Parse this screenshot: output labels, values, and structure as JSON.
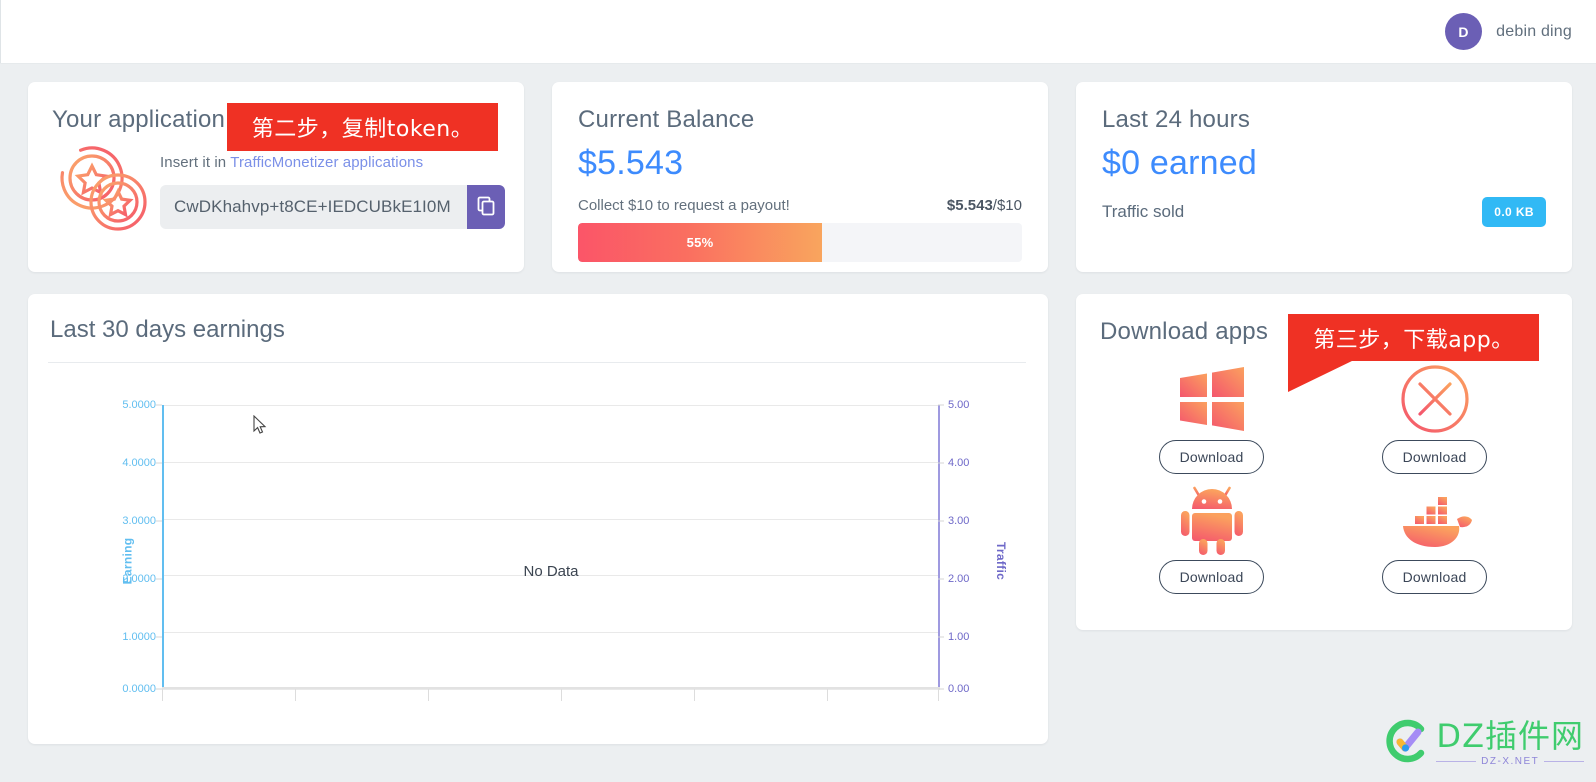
{
  "header": {
    "avatar_initial": "D",
    "user_name": "debin ding"
  },
  "application_card": {
    "title": "Your application",
    "icon": "coins-stars-icon",
    "insert_prefix": "Insert it in ",
    "insert_link": "TrafficMonetizer applications",
    "token_value": "CwDKhahvp+t8CE+IEDCUBkE1I0M",
    "copy_icon": "copy-icon",
    "callout": "第二步，复制token。"
  },
  "balance_card": {
    "title": "Current Balance",
    "amount": "$5.543",
    "collect_text": "Collect $10 to request a payout!",
    "progress_current": "$5.543",
    "progress_target": "/$10",
    "progress_label": "55%",
    "progress_percent": 55
  },
  "hours_card": {
    "title": "Last 24 hours",
    "earned": "$0 earned",
    "traffic_label": "Traffic sold",
    "traffic_value": "0.0 KB"
  },
  "chart_card": {
    "title": "Last 30 days earnings",
    "empty_text": "No Data"
  },
  "apps_card": {
    "title": "Download apps",
    "callout": "第三步，下载app。",
    "apps": [
      {
        "icon": "windows-icon",
        "button": "Download"
      },
      {
        "icon": "circle-x-icon",
        "button": "Download"
      },
      {
        "icon": "android-icon",
        "button": "Download"
      },
      {
        "icon": "docker-icon",
        "button": "Download"
      }
    ]
  },
  "watermark": {
    "main": "DZ插件网",
    "sub": "DZ-X.NET"
  },
  "colors": {
    "accent_blue": "#3d8bfd",
    "avatar_purple": "#6b5fb5",
    "callout_red": "#ef3124",
    "badge_blue": "#31b9f5",
    "earning_axis": "#61bef0",
    "traffic_axis": "#6e68c8",
    "progress_from": "#fb5568",
    "progress_to": "#f9a55e",
    "page_bg": "#eceff1"
  },
  "chart_data": {
    "type": "line",
    "title": "Last 30 days earnings",
    "xlabel": "",
    "empty": true,
    "empty_text": "No Data",
    "grid": true,
    "legend": "none",
    "x": [],
    "series": [
      {
        "name": "Earning",
        "axis": "left",
        "values": [],
        "color": "#61bef0"
      },
      {
        "name": "Traffic",
        "axis": "right",
        "values": [],
        "color": "#6e68c8"
      }
    ],
    "axes": {
      "left": {
        "label": "Earning",
        "ylim": [
          0,
          5
        ],
        "ticks": [
          "0.0000",
          "1.0000",
          "2.0000",
          "3.0000",
          "4.0000",
          "5.0000"
        ],
        "color": "#61bef0"
      },
      "right": {
        "label": "Traffic",
        "ylim": [
          0,
          5
        ],
        "ticks": [
          "0.00",
          "1.00",
          "2.00",
          "3.00",
          "4.00",
          "5.00"
        ],
        "color": "#6e68c8"
      },
      "x": {
        "ticks": [],
        "tick_count": 7
      }
    }
  }
}
